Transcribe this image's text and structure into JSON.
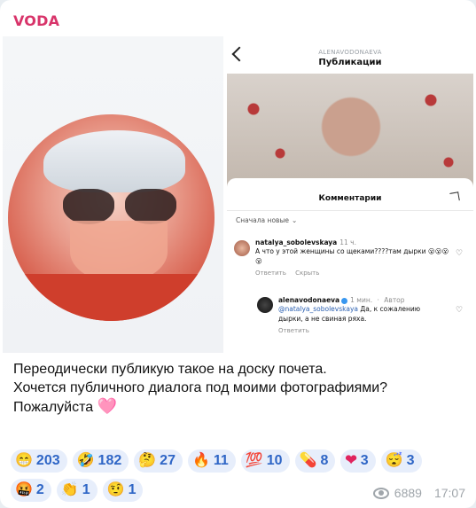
{
  "channel": {
    "name": "VODA"
  },
  "screenshot": {
    "username": "ALENAVODONAEVA",
    "title": "Публикации",
    "sheet_title": "Комментарии",
    "sort_label": "Сначала новые",
    "comments": [
      {
        "user": "natalya_sobolevskaya",
        "time": "11 ч.",
        "text": "А что у этой женщины со щеками????там дырки 😮😮😮😮",
        "reply": "Ответить",
        "hide": "Скрыть"
      },
      {
        "user": "alenavodonaeva",
        "time": "1 мин.",
        "author": "Автор",
        "mention": "@natalya_sobolevskaya",
        "text": "Да, к сожалению дырки, а не свиная ряха.",
        "reply": "Ответить"
      }
    ]
  },
  "message": {
    "line1": "Переодически публикую такое на доску почета.",
    "line2": "Хочется публичного диалога под моими фотографиями?",
    "line3": "Пожалуйста",
    "emoji": "🩷"
  },
  "reactions": [
    {
      "emoji": "😁",
      "count": "203"
    },
    {
      "emoji": "🤣",
      "count": "182"
    },
    {
      "emoji": "🤔",
      "count": "27"
    },
    {
      "emoji": "🔥",
      "count": "11"
    },
    {
      "emoji": "💯",
      "count": "10"
    },
    {
      "emoji": "💊",
      "count": "8"
    },
    {
      "emoji": "❤",
      "count": "3"
    },
    {
      "emoji": "😴",
      "count": "3"
    },
    {
      "emoji": "🤬",
      "count": "2"
    },
    {
      "emoji": "👏",
      "count": "1"
    },
    {
      "emoji": "🤨",
      "count": "1"
    }
  ],
  "meta": {
    "views": "6889",
    "time": "17:07"
  },
  "colors": {
    "accent": "#d8346a",
    "reaction_bg": "#e7eefb",
    "reaction_text": "#2f66c6"
  }
}
